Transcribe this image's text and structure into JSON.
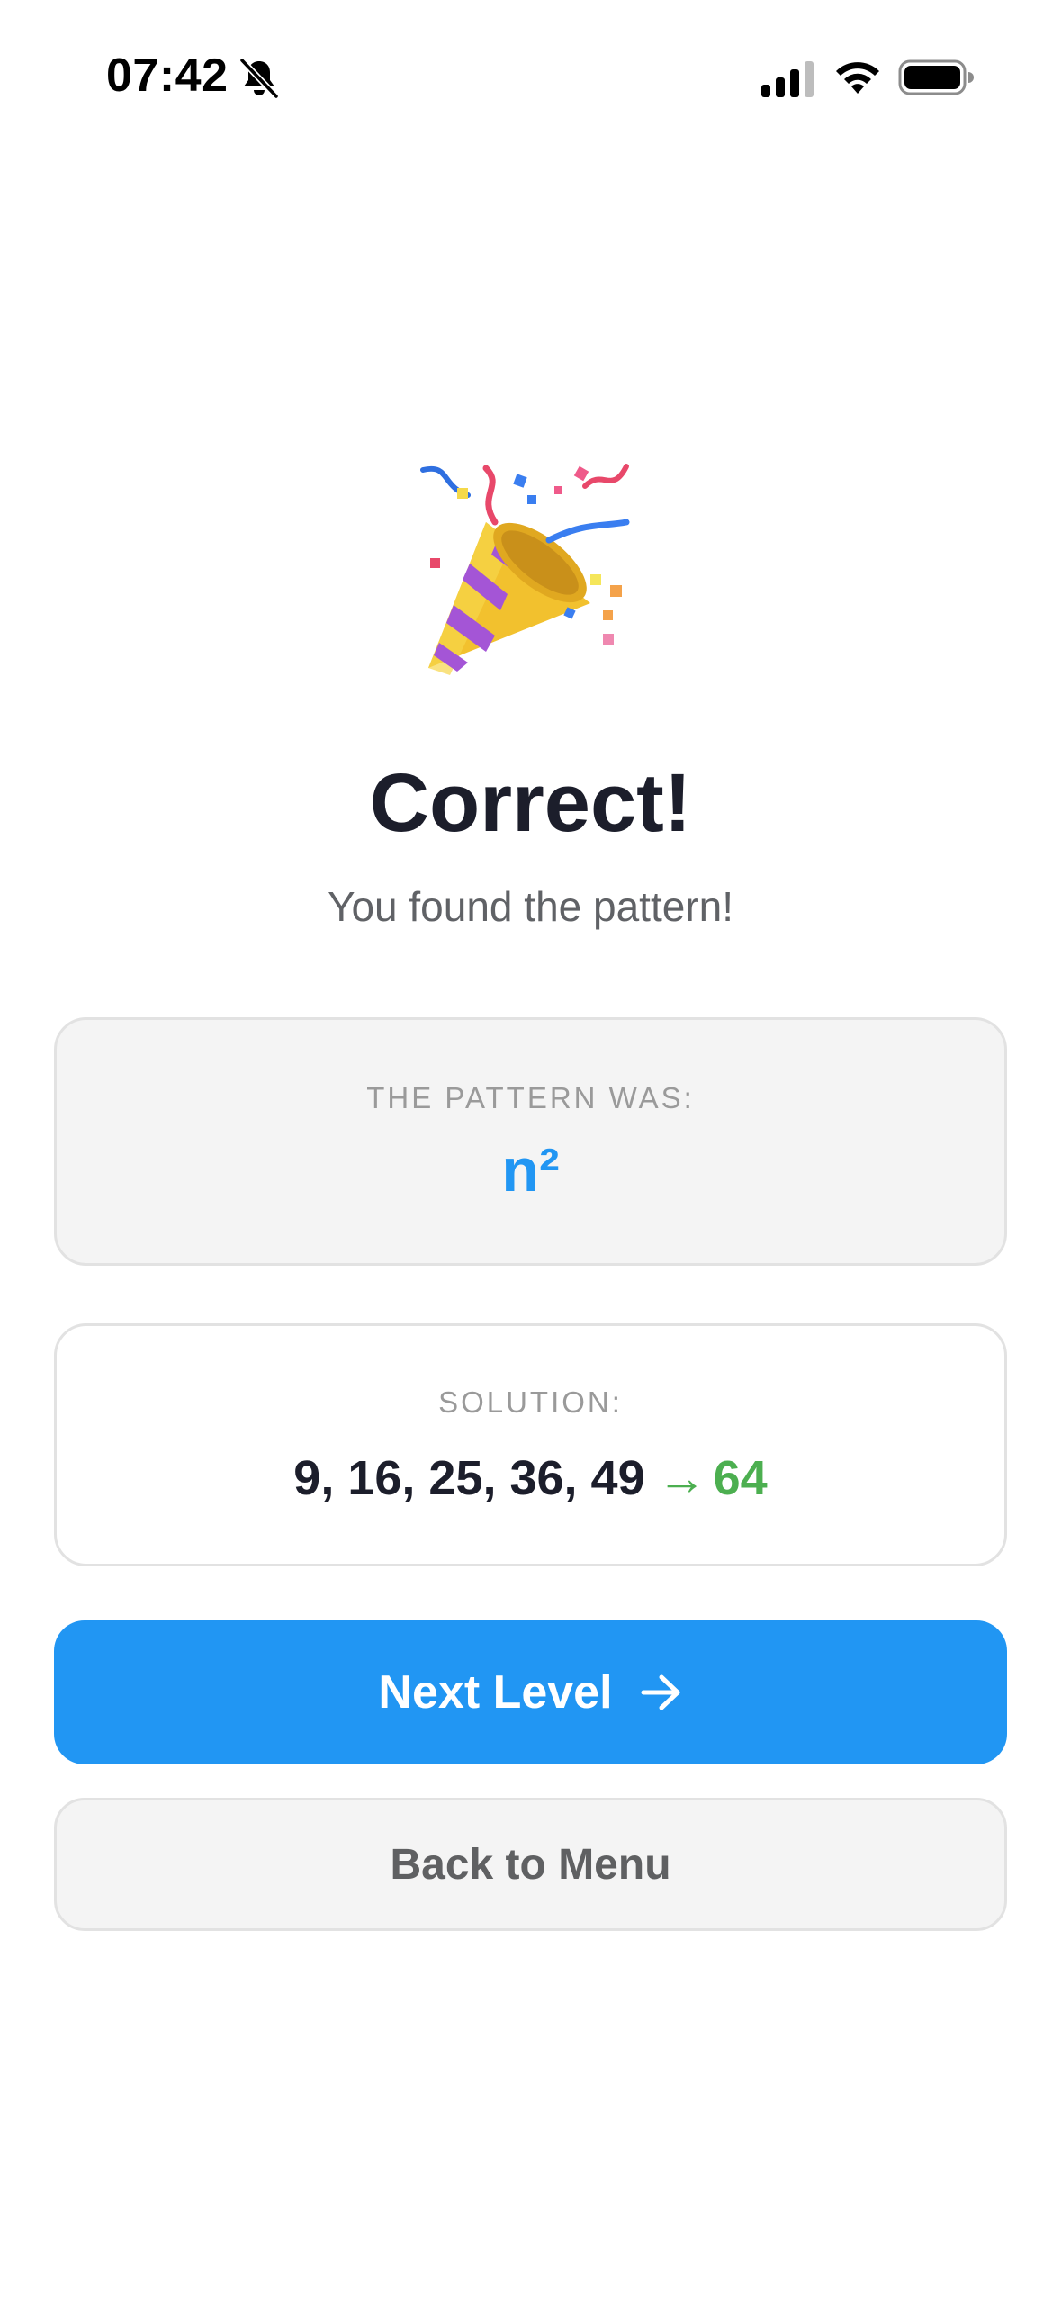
{
  "status_bar": {
    "time": "07:42",
    "icons": [
      "bell-off-icon",
      "signal-icon",
      "wifi-icon",
      "battery-icon"
    ]
  },
  "result": {
    "emoji": "party-popper-icon",
    "title": "Correct!",
    "subtitle": "You found the pattern!"
  },
  "pattern_card": {
    "label": "THE PATTERN WAS:",
    "value": "n²"
  },
  "solution_card": {
    "label": "SOLUTION:",
    "sequence": "9, 16, 25, 36, 49",
    "arrow": "→",
    "answer": "64"
  },
  "buttons": {
    "next_level": "Next Level",
    "next_icon": "arrow-right-icon",
    "back_to_menu": "Back to Menu"
  },
  "colors": {
    "accent": "#2196f3",
    "success": "#4caf50",
    "title": "#1c1e2b",
    "card_bg": "#f4f4f4",
    "card_border": "#e2e2e2"
  }
}
